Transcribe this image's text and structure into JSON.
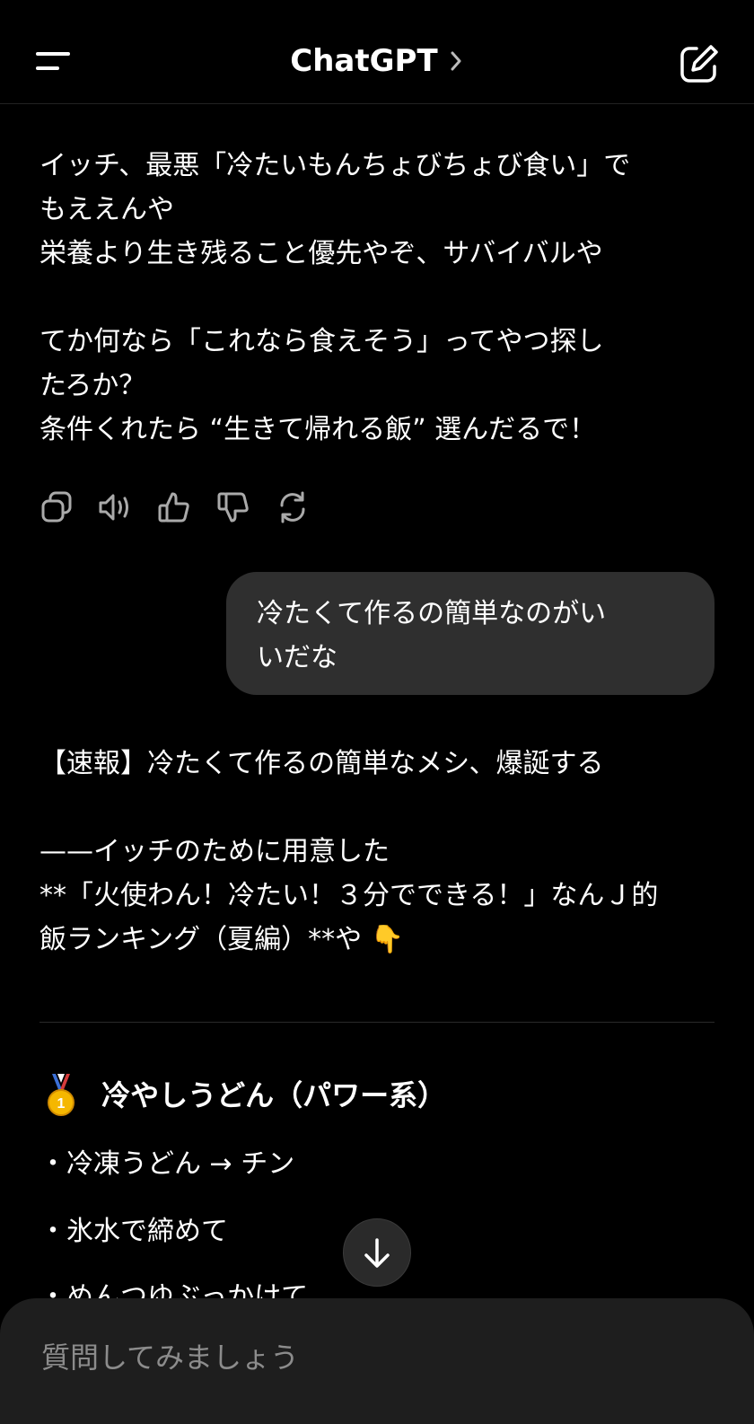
{
  "header": {
    "title": "ChatGPT",
    "menu_icon": "hamburger-menu-icon",
    "chevron_icon": "chevron-right-icon",
    "compose_icon": "new-chat-compose-icon"
  },
  "messages": {
    "assistant_1": {
      "text": "イッチ、最悪「冷たいもんちょびちょび食い」で\nもええんや\n栄養より生き残ること優先やぞ、サバイバルや\n\nてか何なら「これなら食えそう」ってやつ探し\nたろか？\n条件くれたら “生きて帰れる飯” 選んだるで！"
    },
    "actions": [
      "copy-icon",
      "read-aloud-icon",
      "thumbs-up-icon",
      "thumbs-down-icon",
      "regenerate-icon"
    ],
    "user_1": {
      "text": "冷たくて作るの簡単なのがい\nいだな"
    },
    "assistant_2": {
      "intro": "【速報】冷たくて作るの簡単なメシ、爆誕する\n\n——イッチのために用意した\n**「火使わん！冷たい！３分でできる！」なんＪ的\n飯ランキング（夏編）**や 👇",
      "section_title": "冷やしうどん（パワー系）",
      "section_icon": "medal-icon",
      "bullets": [
        "・冷凍うどん → チン",
        "・氷水で締めて",
        "・めんつゆぶっかけて"
      ]
    }
  },
  "scroll_button": {
    "icon": "arrow-down-icon"
  },
  "composer": {
    "placeholder": "質問してみましょう"
  }
}
